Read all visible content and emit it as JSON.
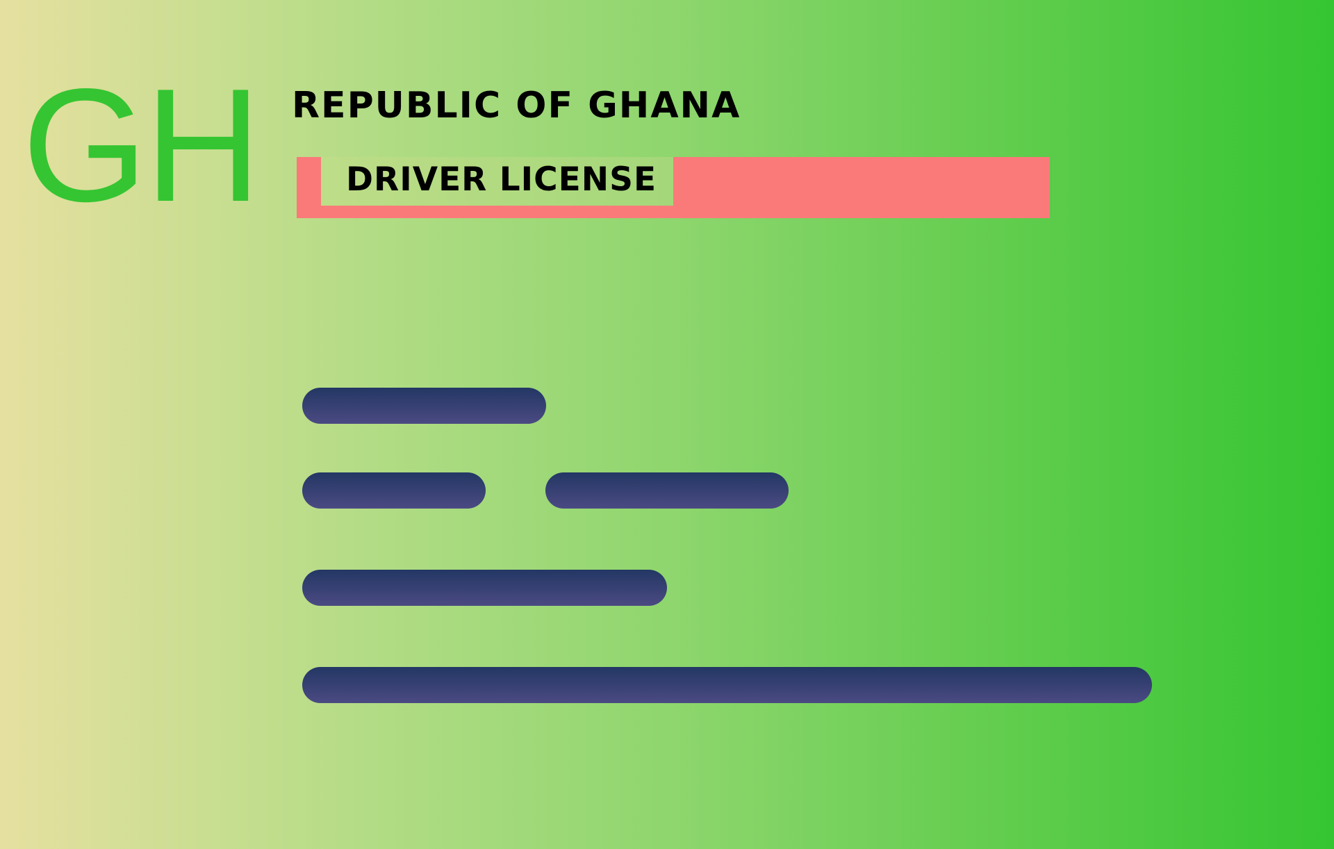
{
  "card": {
    "logo_text": "GH",
    "country_name": "REPUBLIC OF GHANA",
    "document_title": "DRIVER LICENSE"
  },
  "colors": {
    "logo_green": "#35c532",
    "banner_red": "#fa7a7a",
    "field_navy": "#2b3a6a",
    "gradient_start": "#e6e0a0",
    "gradient_end": "#35c532"
  }
}
